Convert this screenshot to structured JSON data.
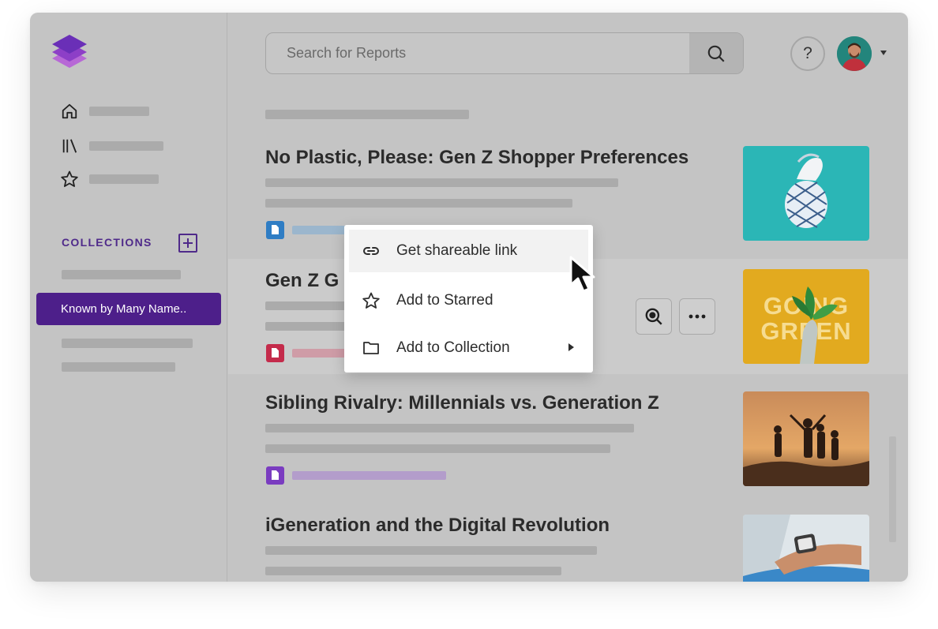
{
  "app": {
    "brand_colors": {
      "primary": "#4d1f8a",
      "accent": "#7a3cc0"
    }
  },
  "search": {
    "placeholder": "Search for Reports",
    "icon": "search-icon"
  },
  "header": {
    "help_label": "?",
    "avatar_icon": "user-avatar",
    "menu_caret_icon": "caret-down-icon"
  },
  "sidebar": {
    "nav_icons": [
      "home-icon",
      "library-icon",
      "star-icon"
    ],
    "collections_title": "COLLECTIONS",
    "add_collection_icon": "plus-box-icon",
    "active_collection": "Known by Many Name.."
  },
  "reports": [
    {
      "title": "No Plastic, Please: Gen Z Shopper Preferences",
      "doc_color": "#2f7dc4",
      "thumb_color": "#2bb6b6"
    },
    {
      "title": "Gen Z G",
      "doc_color": "#c42b4b",
      "thumb_color": "#e2aa1f",
      "thumb_text": "GOING GREEN"
    },
    {
      "title": "Sibling Rivalry: Millennials vs. Generation Z",
      "doc_color": "#7a3cc0",
      "thumb_color": "#8c5a36"
    },
    {
      "title": "iGeneration and the Digital Revolution",
      "doc_color": "#2f7dc4",
      "thumb_color": "#3a88c8"
    }
  ],
  "row_actions": {
    "preview_icon": "zoom-preview-icon",
    "more_icon": "more-horizontal-icon"
  },
  "context_menu": {
    "items": [
      {
        "label": "Get shareable link",
        "icon": "link-icon"
      },
      {
        "label": "Add to Starred",
        "icon": "star-outline-icon"
      },
      {
        "label": "Add to Collection",
        "icon": "folder-icon",
        "submenu_icon": "chevron-right-icon"
      }
    ]
  }
}
